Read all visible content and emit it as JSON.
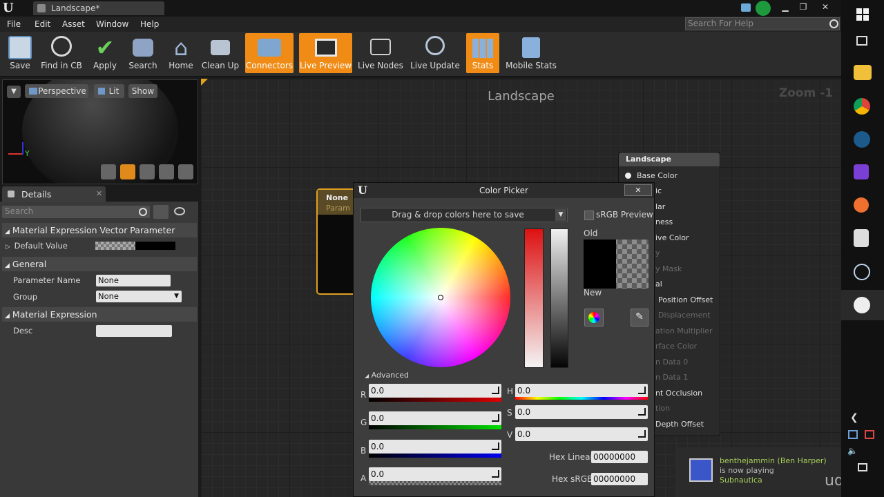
{
  "window": {
    "tab_title": "Landscape*",
    "controls": [
      "▁",
      "❐",
      "✕"
    ]
  },
  "menu": [
    "File",
    "Edit",
    "Asset",
    "Window",
    "Help"
  ],
  "search_help": {
    "placeholder": "Search For Help"
  },
  "toolbar": [
    {
      "label": "Save",
      "icon": "save-icon",
      "active": false
    },
    {
      "label": "Find in CB",
      "icon": "magnifier-icon",
      "active": false
    },
    {
      "label": "Apply",
      "icon": "checkmark-icon",
      "active": false
    },
    {
      "label": "Search",
      "icon": "binoculars-icon",
      "active": false
    },
    {
      "label": "Home",
      "icon": "home-icon",
      "active": false
    },
    {
      "label": "Clean Up",
      "icon": "broom-icon",
      "active": false
    },
    {
      "label": "Connectors",
      "icon": "connectors-icon",
      "active": true
    },
    {
      "label": "Live Preview",
      "icon": "monitor-icon",
      "active": true
    },
    {
      "label": "Live Nodes",
      "icon": "nodes-icon",
      "active": false
    },
    {
      "label": "Live Update",
      "icon": "refresh-icon",
      "active": false
    },
    {
      "label": "Stats",
      "icon": "stats-icon",
      "active": true
    },
    {
      "label": "Mobile Stats",
      "icon": "mobile-stats-icon",
      "active": false
    }
  ],
  "viewport": {
    "perspective": "Perspective",
    "lit": "Lit",
    "show": "Show",
    "axis_y": "Y"
  },
  "details": {
    "tab": "Details",
    "search_placeholder": "Search",
    "sections": {
      "vector": "Material Expression Vector Parameter",
      "general": "General",
      "expression": "Material Expression"
    },
    "default_value_label": "Default Value",
    "param_name_label": "Parameter Name",
    "param_name_value": "None",
    "group_label": "Group",
    "group_value": "None",
    "desc_label": "Desc",
    "desc_value": ""
  },
  "graph": {
    "title": "Landscape",
    "zoom": "Zoom -1"
  },
  "param_node": {
    "title": "None",
    "subtitle": "Param ("
  },
  "landscape_node": {
    "title": "Landscape",
    "pins": [
      {
        "label": "Base Color",
        "dim": false
      },
      {
        "label": "ic",
        "dim": false
      },
      {
        "label": "lar",
        "dim": false
      },
      {
        "label": "ness",
        "dim": false
      },
      {
        "label": "ive Color",
        "dim": false
      },
      {
        "label": "y",
        "dim": true
      },
      {
        "label": "y Mask",
        "dim": true
      },
      {
        "label": "al",
        "dim": false
      },
      {
        "label": "Position Offset",
        "dim": false
      },
      {
        "label": "Displacement",
        "dim": true
      },
      {
        "label": "ation Multiplier",
        "dim": true
      },
      {
        "label": "rface Color",
        "dim": true
      },
      {
        "label": "n Data 0",
        "dim": true
      },
      {
        "label": "n Data 1",
        "dim": true
      },
      {
        "label": "nt Occlusion",
        "dim": false
      },
      {
        "label": "tion",
        "dim": true
      },
      {
        "label": "Depth Offset",
        "dim": false
      }
    ]
  },
  "color_picker": {
    "title": "Color Picker",
    "drop_hint": "Drag & drop colors here to save",
    "srgb_preview": "sRGB Preview",
    "old": "Old",
    "new": "New",
    "advanced": "Advanced",
    "r_label": "R",
    "g_label": "G",
    "b_label": "B",
    "a_label": "A",
    "r": "0.0",
    "g": "0.0",
    "b": "0.0",
    "a": "0.0",
    "h_label": "H",
    "s_label": "S",
    "v_label": "V",
    "h": "0.0",
    "s": "0.0",
    "v": "0.0",
    "hex_linear_label": "Hex Linear",
    "hex_linear": "00000000",
    "hex_srgb_label": "Hex sRGB",
    "hex_srgb": "00000000"
  },
  "toast": {
    "user": "benthejammin (Ben Harper)",
    "status": "is now playing",
    "game": "Subnautica"
  },
  "watermark": "udemy",
  "taskbar_icons": [
    "windows-icon",
    "task-view-icon",
    "file-explorer-icon",
    "chrome-icon",
    "steam-icon",
    "visual-studio-icon",
    "paint-icon",
    "epic-games-icon",
    "network-icon",
    "unreal-icon"
  ]
}
